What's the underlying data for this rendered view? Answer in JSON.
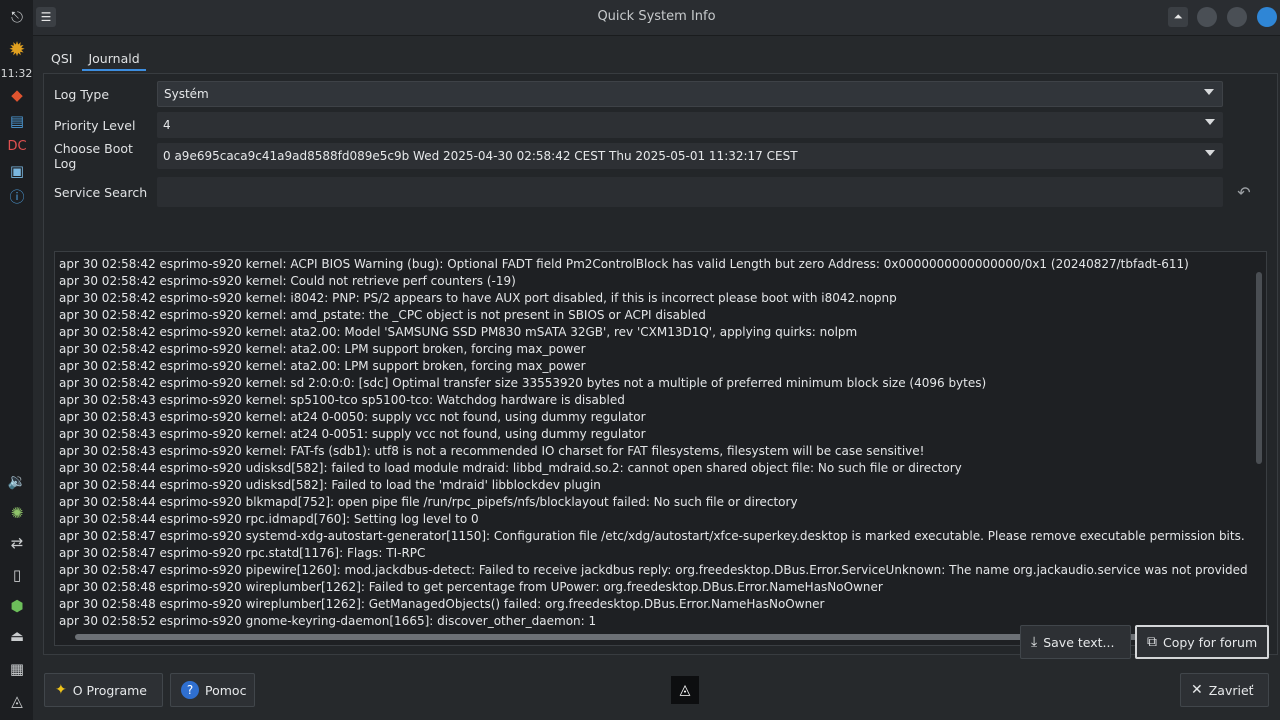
{
  "clock": "11:32",
  "window": {
    "title": "Quick System Info"
  },
  "tabs": [
    "QSI",
    "Journald"
  ],
  "form": {
    "log_type_label": "Log Type",
    "log_type_value": "Systém",
    "priority_label": "Priority Level",
    "priority_value": "4",
    "boot_label": "Choose Boot Log",
    "boot_value": "0 a9e695caca9c41a9ad8588fd089e5c9b Wed 2025-04-30 02:58:42 CEST Thu 2025-05-01 11:32:17 CEST",
    "service_label": "Service Search",
    "service_value": ""
  },
  "log_lines": [
    "apr 30 02:58:42 esprimo-s920 kernel: ACPI BIOS Warning (bug): Optional FADT field Pm2ControlBlock has valid Length but zero Address: 0x0000000000000000/0x1 (20240827/tbfadt-611)",
    "apr 30 02:58:42 esprimo-s920 kernel: Could not retrieve perf counters (-19)",
    "apr 30 02:58:42 esprimo-s920 kernel: i8042: PNP: PS/2 appears to have AUX port disabled, if this is incorrect please boot with i8042.nopnp",
    "apr 30 02:58:42 esprimo-s920 kernel: amd_pstate: the _CPC object is not present in SBIOS or ACPI disabled",
    "apr 30 02:58:42 esprimo-s920 kernel: ata2.00: Model 'SAMSUNG SSD PM830 mSATA 32GB', rev 'CXM13D1Q', applying quirks: nolpm",
    "apr 30 02:58:42 esprimo-s920 kernel: ata2.00: LPM support broken, forcing max_power",
    "apr 30 02:58:42 esprimo-s920 kernel: ata2.00: LPM support broken, forcing max_power",
    "apr 30 02:58:42 esprimo-s920 kernel: sd 2:0:0:0: [sdc] Optimal transfer size 33553920 bytes not a multiple of preferred minimum block size (4096 bytes)",
    "apr 30 02:58:43 esprimo-s920 kernel: sp5100-tco sp5100-tco: Watchdog hardware is disabled",
    "apr 30 02:58:43 esprimo-s920 kernel: at24 0-0050: supply vcc not found, using dummy regulator",
    "apr 30 02:58:43 esprimo-s920 kernel: at24 0-0051: supply vcc not found, using dummy regulator",
    "apr 30 02:58:43 esprimo-s920 kernel: FAT-fs (sdb1): utf8 is not a recommended IO charset for FAT filesystems, filesystem will be case sensitive!",
    "apr 30 02:58:44 esprimo-s920 udisksd[582]: failed to load module mdraid: libbd_mdraid.so.2: cannot open shared object file: No such file or directory",
    "apr 30 02:58:44 esprimo-s920 udisksd[582]: Failed to load the 'mdraid' libblockdev plugin",
    "apr 30 02:58:44 esprimo-s920 blkmapd[752]: open pipe file /run/rpc_pipefs/nfs/blocklayout failed: No such file or directory",
    "apr 30 02:58:44 esprimo-s920 rpc.idmapd[760]: Setting log level to 0",
    "apr 30 02:58:47 esprimo-s920 systemd-xdg-autostart-generator[1150]: Configuration file /etc/xdg/autostart/xfce-superkey.desktop is marked executable. Please remove executable permission bits. Proceeding",
    "apr 30 02:58:47 esprimo-s920 rpc.statd[1176]: Flags: TI-RPC",
    "apr 30 02:58:47 esprimo-s920 pipewire[1260]: mod.jackdbus-detect: Failed to receive jackdbus reply: org.freedesktop.DBus.Error.ServiceUnknown: The name org.jackaudio.service was not provided by any .serv",
    "apr 30 02:58:48 esprimo-s920 wireplumber[1262]: Failed to get percentage from UPower: org.freedesktop.DBus.Error.NameHasNoOwner",
    "apr 30 02:58:48 esprimo-s920 wireplumber[1262]: GetManagedObjects() failed: org.freedesktop.DBus.Error.NameHasNoOwner",
    "apr 30 02:58:52 esprimo-s920 gnome-keyring-daemon[1665]: discover_other_daemon: 1"
  ],
  "buttons": {
    "save_text": "Save text...",
    "copy_forum": "Copy for forum",
    "about": "O Programe",
    "help": "Pomoc",
    "close": "Zavrieť"
  }
}
